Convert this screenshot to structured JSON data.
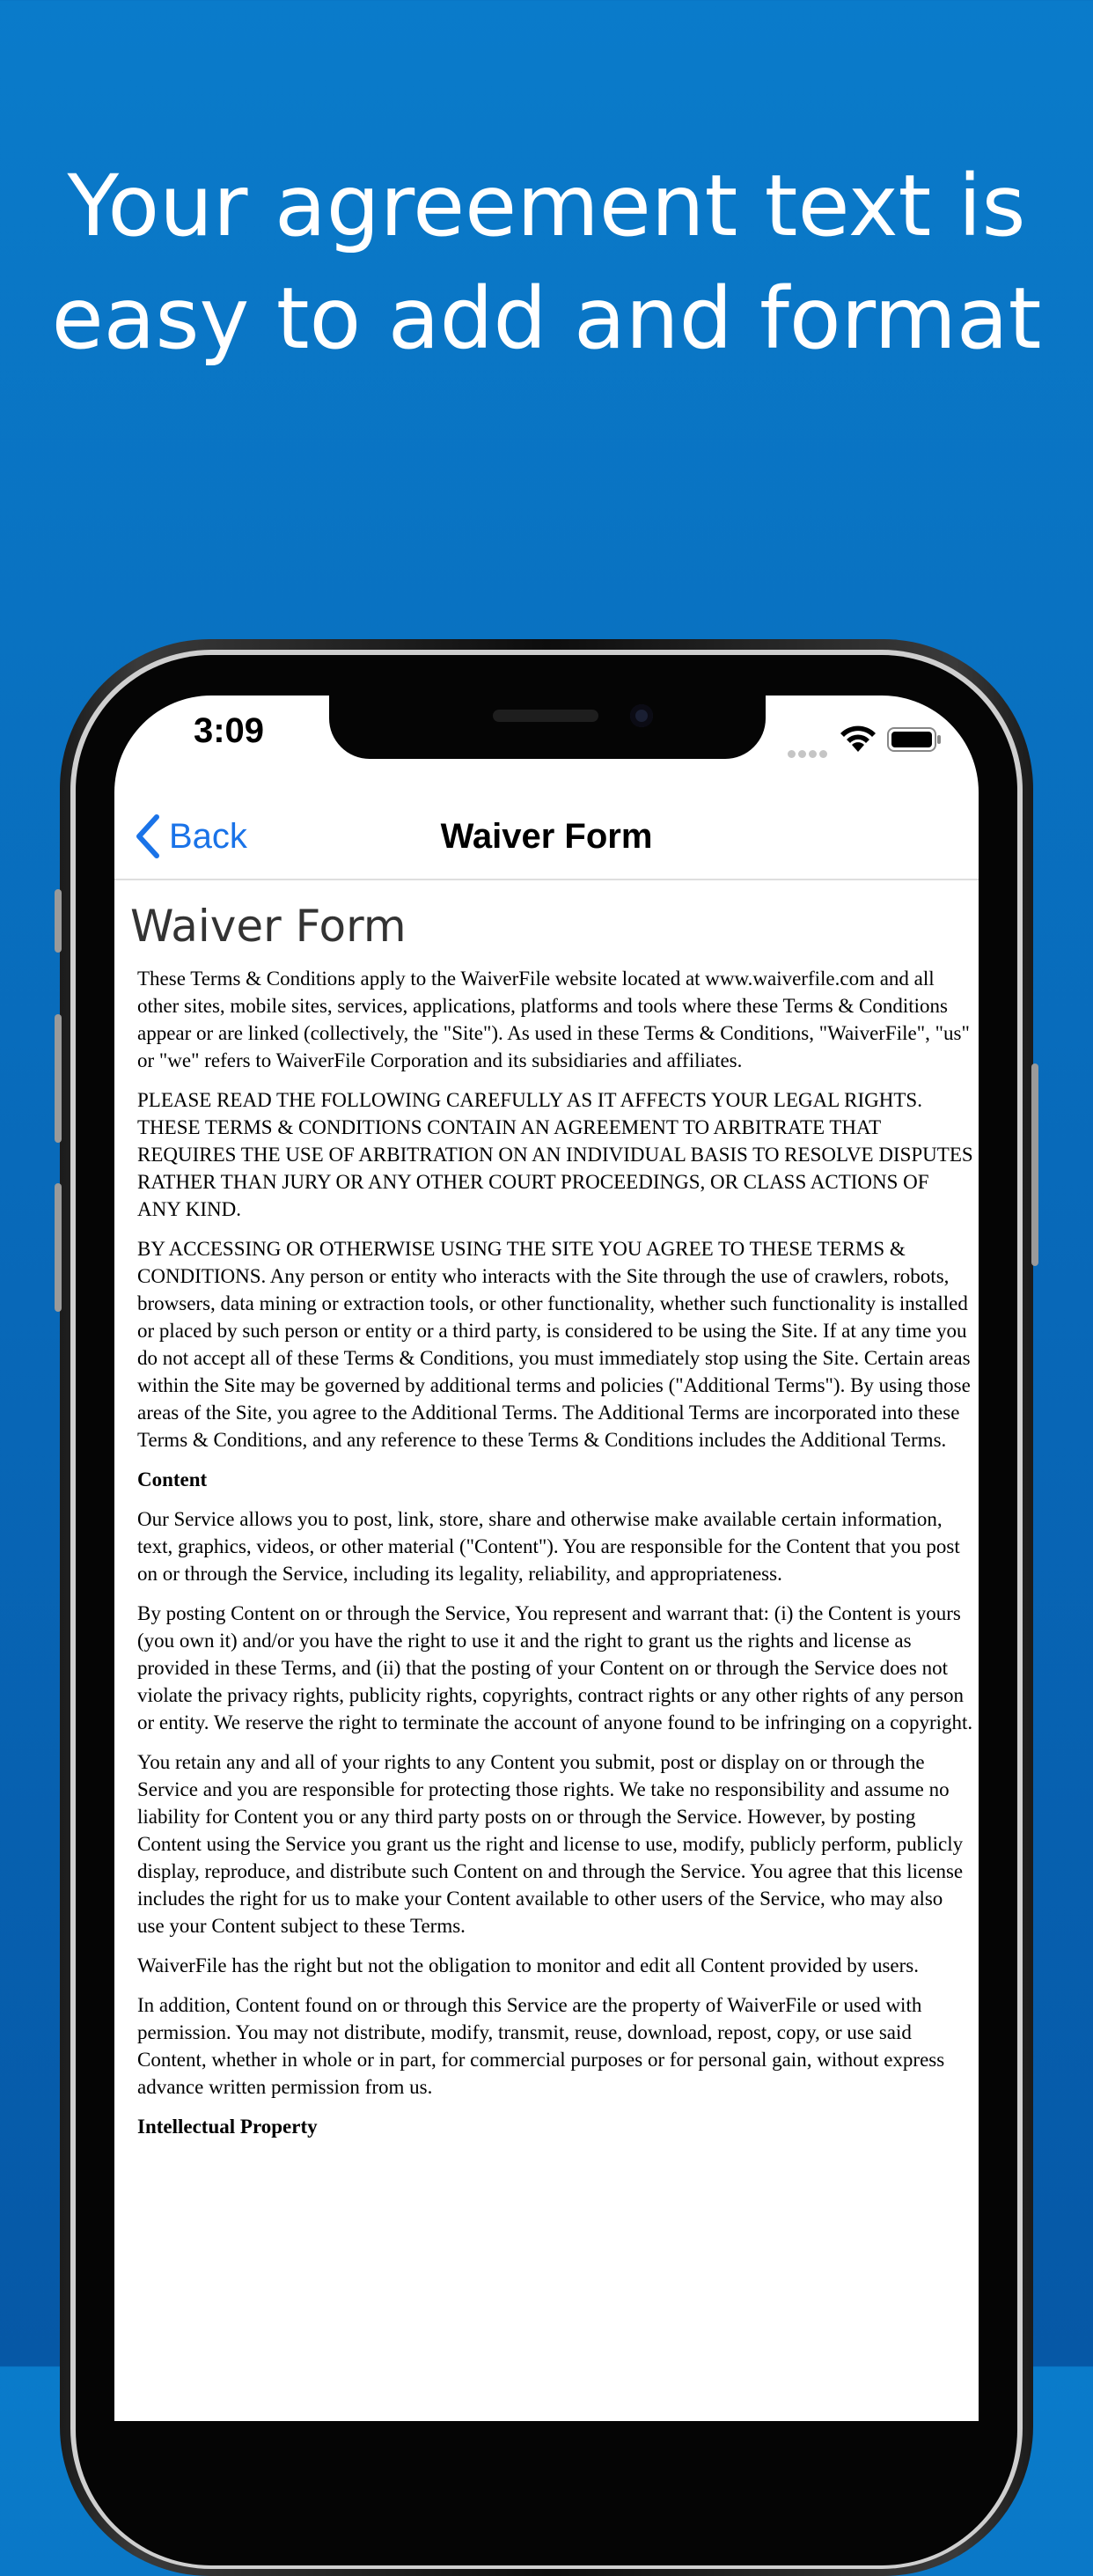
{
  "promo": {
    "line1": "Your agreement text is",
    "line2": "easy to add and format"
  },
  "status_bar": {
    "time": "3:09"
  },
  "nav": {
    "back_label": "Back",
    "title": "Waiver Form"
  },
  "document": {
    "heading": "Waiver Form",
    "p1": "These Terms & Conditions apply to the WaiverFile website located at www.waiverfile.com and all other sites, mobile sites, services, applications, platforms and tools where these Terms & Conditions appear or are linked (collectively, the \"Site\"). As used in these Terms & Conditions, \"WaiverFile\", \"us\" or \"we\" refers to WaiverFile Corporation and its subsidiaries and affiliates.",
    "p2": "PLEASE READ THE FOLLOWING CAREFULLY AS IT AFFECTS YOUR LEGAL RIGHTS. THESE TERMS & CONDITIONS CONTAIN AN AGREEMENT TO ARBITRATE THAT REQUIRES THE USE OF ARBITRATION ON AN INDIVIDUAL BASIS TO RESOLVE DISPUTES RATHER THAN JURY OR ANY OTHER COURT PROCEEDINGS, OR CLASS ACTIONS OF ANY KIND.",
    "p3": "BY ACCESSING OR OTHERWISE USING THE SITE YOU AGREE TO THESE TERMS & CONDITIONS. Any person or entity who interacts with the Site through the use of crawlers, robots, browsers, data mining or extraction tools, or other functionality, whether such functionality is installed or placed by such person or entity or a third party, is considered to be using the Site. If at any time you do not accept all of these Terms & Conditions, you must immediately stop using the Site. Certain areas within the Site may be governed by additional terms and policies (\"Additional Terms\"). By using those areas of the Site, you agree to the Additional Terms. The Additional Terms are incorporated into these Terms & Conditions, and any reference to these Terms & Conditions includes the Additional Terms.",
    "section_content": "Content",
    "p4": "Our Service allows you to post, link, store, share and otherwise make available certain information, text, graphics, videos, or other material (\"Content\"). You are responsible for the Content that you post on or through the Service, including its legality, reliability, and appropriateness.",
    "p5": "By posting Content on or through the Service, You represent and warrant that: (i) the Content is yours (you own it) and/or you have the right to use it and the right to grant us the rights and license as provided in these Terms, and (ii) that the posting of your Content on or through the Service does not violate the privacy rights, publicity rights, copyrights, contract rights or any other rights of any person or entity. We reserve the right to terminate the account of anyone found to be infringing on a copyright.",
    "p6": "You retain any and all of your rights to any Content you submit, post or display on or through the Service and you are responsible for protecting those rights. We take no responsibility and assume no liability for Content you or any third party posts on or through the Service. However, by posting Content using the Service you grant us the right and license to use, modify, publicly perform, publicly display, reproduce, and distribute such Content on and through the Service. You agree that this license includes the right for us to make your Content available to other users of the Service, who may also use your Content subject to these Terms.",
    "p7": "WaiverFile has the right but not the obligation to monitor and edit all Content provided by users.",
    "p8": "In addition, Content found on or through this Service are the property of WaiverFile or used with permission. You may not distribute, modify, transmit, reuse, download, repost, copy, or use said Content, whether in whole or in part, for commercial purposes or for personal gain, without express advance written permission from us.",
    "section_ip": "Intellectual Property"
  },
  "colors": {
    "background_top": "#0a7bca",
    "background_bottom": "#0658a6",
    "accent": "#1a73e8"
  }
}
